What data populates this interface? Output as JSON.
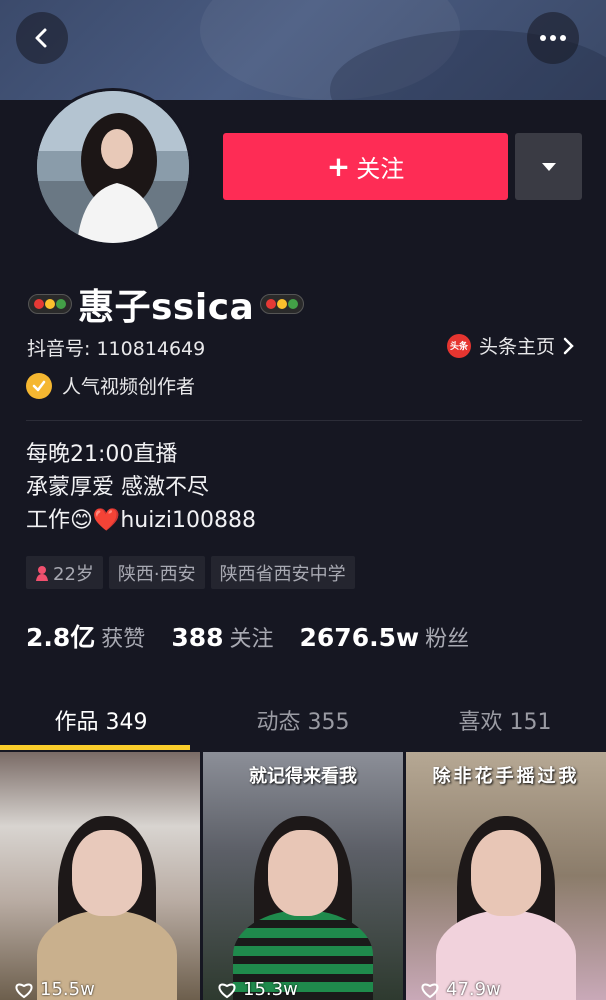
{
  "header": {
    "back_icon": "chevron-left-icon",
    "more_icon": "ellipsis-icon"
  },
  "profile": {
    "name": "惠子ssica",
    "douyin_id": "抖音号: 110814649",
    "toutiao_icon_text": "头条",
    "toutiao_link": "头条主页",
    "creator_badge": "人气视频创作者",
    "follow_label": "关注",
    "bio": [
      "每晚21:00直播",
      "承蒙厚爱 感激不尽",
      "工作😊❤️huizi100888"
    ],
    "tags": {
      "age": "22岁",
      "region": "陕西·西安",
      "school": "陕西省西安中学"
    },
    "stats": {
      "likes_value": "2.8亿",
      "likes_label": "获赞",
      "following_value": "388",
      "following_label": "关注",
      "followers_value": "2676.5w",
      "followers_label": "粉丝"
    }
  },
  "tabs": [
    {
      "label": "作品 349",
      "active": true
    },
    {
      "label": "动态 355",
      "active": false
    },
    {
      "label": "喜欢 151",
      "active": false
    }
  ],
  "videos": [
    {
      "caption": "",
      "likes": "15.5w"
    },
    {
      "caption": "就记得来看我",
      "likes": "15.3w"
    },
    {
      "caption": "除非花手摇过我",
      "likes": "47.9w"
    }
  ],
  "colors": {
    "background": "#161722",
    "follow_button": "#fe2c55",
    "tab_indicator": "#facd2b",
    "badge_gold": "#f5b731"
  }
}
